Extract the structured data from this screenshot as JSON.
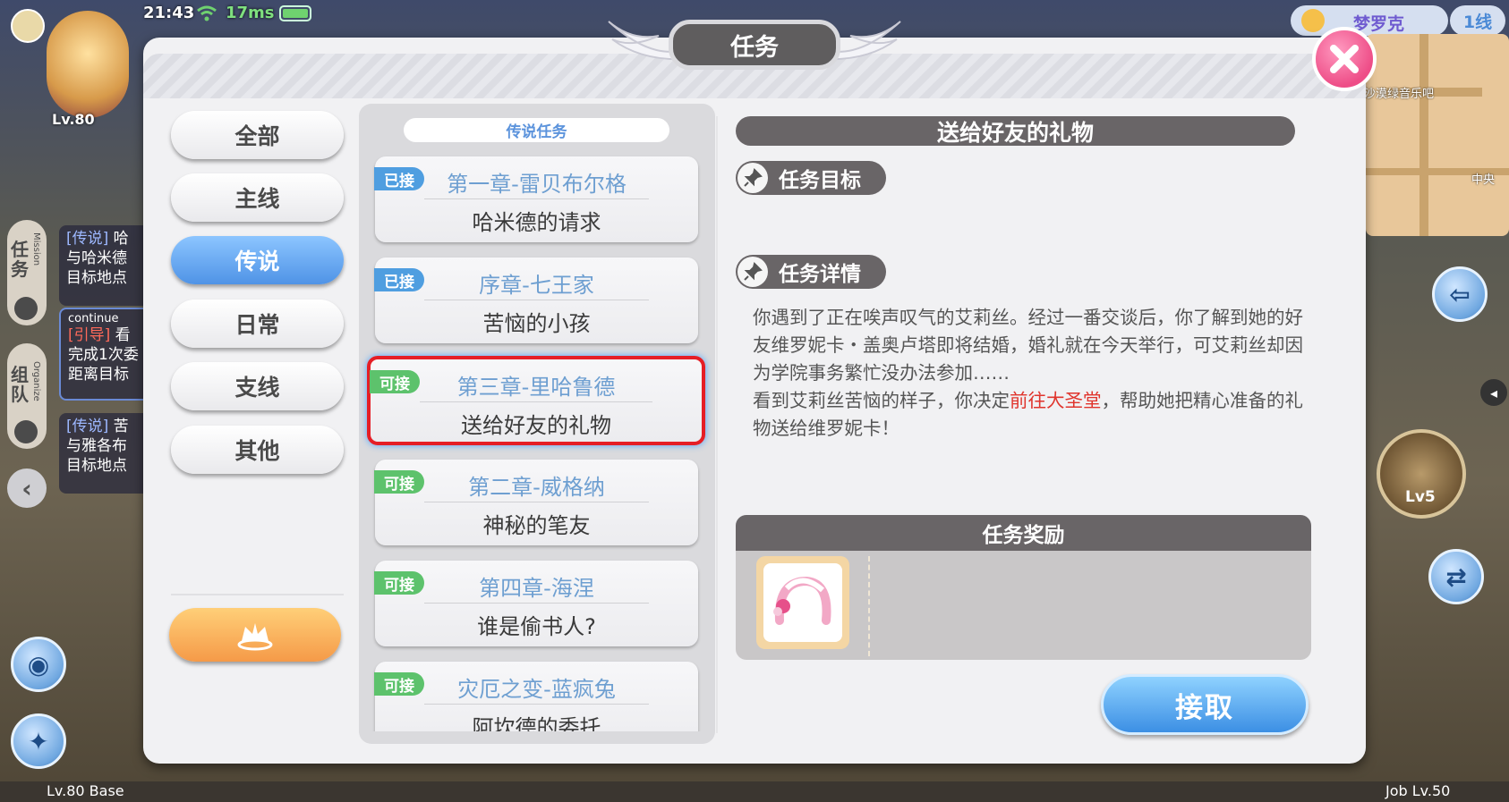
{
  "status_bar": {
    "time": "21:43",
    "ping": "17ms"
  },
  "player": {
    "level": "Lv.80"
  },
  "top_right": {
    "city": "梦罗克",
    "channel": "1线"
  },
  "minimap": {
    "labels": [
      "沙漠绿音乐吧",
      "中央"
    ]
  },
  "left_hud": {
    "mission_tab": "任务",
    "mission_tab_en": "Mission",
    "team_tab": "组队",
    "team_tab_en": "Organize",
    "tracker_1": {
      "tag": "[传说]",
      "line1": "哈",
      "line2": "与哈米德",
      "line3": "目标地点"
    },
    "tracker_2": {
      "header": "continue",
      "tag": "[引导]",
      "line1": "看",
      "line2": "完成1次委",
      "line3": "距离目标"
    },
    "tracker_3": {
      "tag": "[传说]",
      "line1": "苦",
      "line2": "与雅各布",
      "line3": "目标地点"
    }
  },
  "right_hud": {
    "skill_level": "Lv5"
  },
  "bottom": {
    "base": "Lv.80 Base",
    "job": "Job Lv.50"
  },
  "dialog": {
    "title": "任务",
    "categories": [
      {
        "label": "全部",
        "active": false
      },
      {
        "label": "主线",
        "active": false
      },
      {
        "label": "传说",
        "active": true
      },
      {
        "label": "日常",
        "active": false
      },
      {
        "label": "支线",
        "active": false
      },
      {
        "label": "其他",
        "active": false
      }
    ],
    "list_header": "传说任务",
    "quests": [
      {
        "status": "已接",
        "chapter": "第一章-雷贝布尔格",
        "name": "哈米德的请求"
      },
      {
        "status": "已接",
        "chapter": "序章-七王家",
        "name": "苦恼的小孩"
      },
      {
        "status": "可接",
        "chapter": "第三章-里哈鲁德",
        "name": "送给好友的礼物"
      },
      {
        "status": "可接",
        "chapter": "第二章-威格纳",
        "name": "神秘的笔友"
      },
      {
        "status": "可接",
        "chapter": "第四章-海涅",
        "name": "谁是偷书人?"
      },
      {
        "status": "可接",
        "chapter": "灾厄之变-蓝疯兔",
        "name": "阿坎德的委托"
      }
    ],
    "detail": {
      "title": "送给好友的礼物",
      "objective_label": "任务目标",
      "details_label": "任务详情",
      "text_before": "你遇到了正在唉声叹气的艾莉丝。经过一番交谈后，你了解到她的好友维罗妮卡・盖奥卢塔即将结婚，婚礼就在今天举行，可艾莉丝却因为学院事务繁忙没办法参加……",
      "text_line2_start": "看到艾莉丝苦恼的样子，你决定",
      "text_highlight": "前往大圣堂",
      "text_line2_end": "，帮助她把精心准备的礼物送给维罗妮卡！",
      "reward_label": "任务奖励",
      "accept_label": "接取"
    }
  }
}
